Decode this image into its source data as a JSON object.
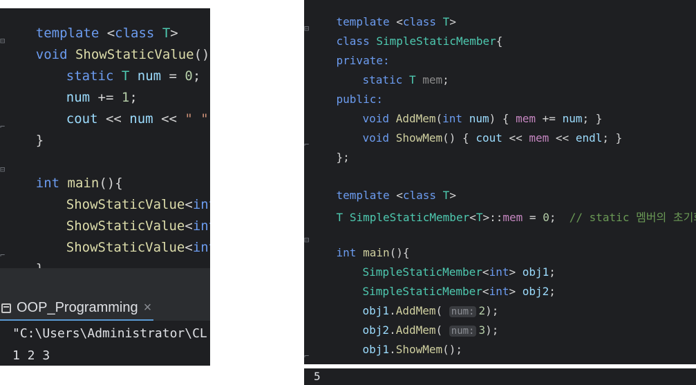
{
  "left": {
    "tokens": {
      "template": "template",
      "lt": " <",
      "class": "class",
      "T": "T",
      "gt": ">",
      "void": "void",
      "fname": "ShowStaticValue",
      "paren_brace": "(){",
      "static": "static",
      "num": "num",
      "assign0": " = ",
      "zero": "0",
      "semi": ";",
      "pluseq": " += ",
      "one": "1",
      "cout": "cout",
      "shl": " << ",
      "space_str": "\" \"",
      "close_brace": "}",
      "int": "int",
      "main": "main",
      "call_open": "<",
      "call_close": ">();"
    },
    "terminal": {
      "tab_label": "OOP_Programming",
      "close": "×",
      "path": "\"C:\\Users\\Administrator\\CL",
      "output": "1 2 3"
    }
  },
  "right": {
    "tokens": {
      "template": "template",
      "class": "class",
      "T": "T",
      "class_name": "SimpleStaticMember",
      "brace_open": "{",
      "private": "private:",
      "static": "static",
      "mem": "mem",
      "public": "public:",
      "void": "void",
      "AddMem": "AddMem",
      "int": "int",
      "num": "num",
      "ShowMem": "ShowMem",
      "cout": "cout",
      "endl": "endl",
      "close_struct": "};",
      "scope": "::",
      "eq0": " = ",
      "zero": "0",
      "comment": "// static 멤버의 초기화",
      "main": "main",
      "obj1": "obj1",
      "obj2": "obj2",
      "hint_num": "num:",
      "two": "2",
      "three": "3"
    },
    "output": "5"
  }
}
